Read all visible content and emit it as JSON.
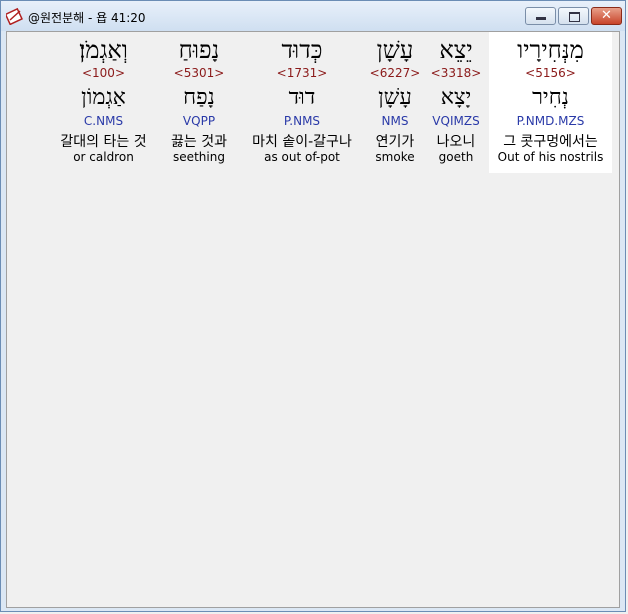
{
  "window": {
    "title": "@원전분해 - 욥 41:20"
  },
  "words": [
    {
      "hebrew_inflected": "מִנְּחִירָיו",
      "strong": "<5156>",
      "hebrew_lemma": "נְחִיר",
      "morphology": "P.NMD.MZS",
      "korean": "그 콧구멍에서는",
      "english": "Out of his nostrils"
    },
    {
      "hebrew_inflected": "יֵצֵא",
      "strong": "<3318>",
      "hebrew_lemma": "יָצָא",
      "morphology": "VQIMZS",
      "korean": "나오니",
      "english": "goeth"
    },
    {
      "hebrew_inflected": "עָשָׁן",
      "strong": "<6227>",
      "hebrew_lemma": "עָשָׁן",
      "morphology": "NMS",
      "korean": "연기가",
      "english": "smoke"
    },
    {
      "hebrew_inflected": "כְּדוּד",
      "strong": "<1731>",
      "hebrew_lemma": "דוּד",
      "morphology": "P.NMS",
      "korean": "마치 솥이-갈구나",
      "english": "as out of-pot"
    },
    {
      "hebrew_inflected": "נָפוּחַ",
      "strong": "<5301>",
      "hebrew_lemma": "נָפַח",
      "morphology": "VQPP",
      "korean": "끓는 것과",
      "english": "seething"
    },
    {
      "hebrew_inflected": "וְאַגְמֹן׃",
      "strong": "<100>",
      "hebrew_lemma": "אַגְמוֹן",
      "morphology": "C.NMS",
      "korean": "갈대의 타는 것",
      "english": "or caldron"
    }
  ]
}
